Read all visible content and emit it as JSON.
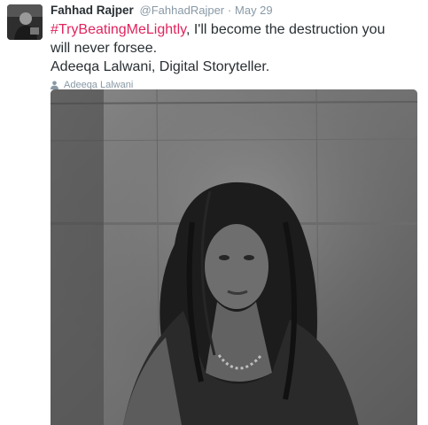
{
  "tweet": {
    "author": {
      "fullname": "Fahhad Rajper",
      "username": "@FahhadRajper",
      "separator": "·",
      "timestamp": "May 29",
      "avatar_icon": "user-avatar-photo"
    },
    "text": {
      "hashtag": "#TryBeatingMeLightly",
      "body": ", I'll become the destruction you will never forsee.",
      "line2": "Adeeqa Lalwani, Digital Storyteller."
    },
    "tagged_user": {
      "icon": "person-icon",
      "name": "Adeeqa Lalwani"
    },
    "media": {
      "type": "photo",
      "style": "black-and-white"
    }
  },
  "colors": {
    "hashtag": "#e0245e",
    "name": "#292f33",
    "meta": "#8899a6"
  }
}
